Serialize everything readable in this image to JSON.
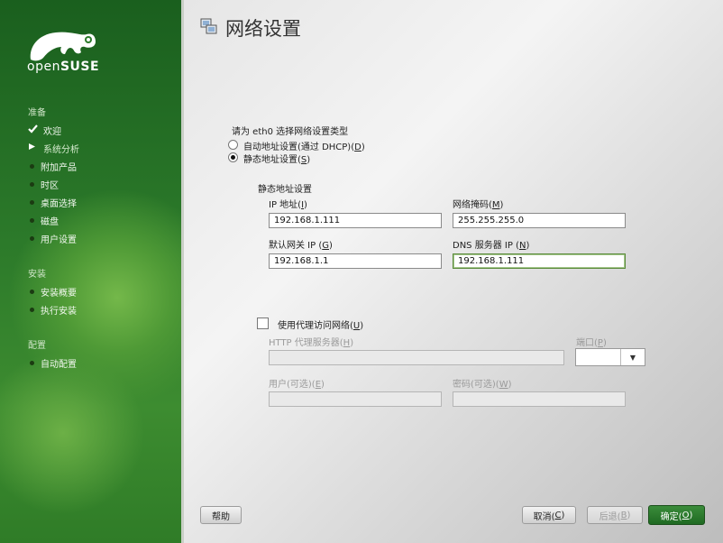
{
  "brand": {
    "logo_text_a": "open",
    "logo_text_b": "SUSE"
  },
  "sidebar": {
    "sections": [
      {
        "title": "准备",
        "items": [
          {
            "label": "欢迎",
            "state": "done"
          },
          {
            "label": "系统分析",
            "state": "current"
          },
          {
            "label": "附加产品",
            "state": "pending"
          },
          {
            "label": "时区",
            "state": "pending"
          },
          {
            "label": "桌面选择",
            "state": "pending"
          },
          {
            "label": "磁盘",
            "state": "pending"
          },
          {
            "label": "用户设置",
            "state": "pending"
          }
        ]
      },
      {
        "title": "安装",
        "items": [
          {
            "label": "安装概要",
            "state": "pending"
          },
          {
            "label": "执行安装",
            "state": "pending"
          }
        ]
      },
      {
        "title": "配置",
        "items": [
          {
            "label": "自动配置",
            "state": "pending"
          }
        ]
      }
    ]
  },
  "page": {
    "title": "网络设置"
  },
  "setup": {
    "prompt": "请为 eth0 选择网络设置类型",
    "dhcp_label": "自动地址设置(通过 DHCP)(",
    "dhcp_key": "D",
    "static_label": "静态地址设置(",
    "static_key": "S",
    "selected": "static"
  },
  "static": {
    "group_title": "静态地址设置",
    "ip_label": "IP 地址(",
    "ip_key": "I",
    "ip_value": "192.168.1.111",
    "mask_label": "网络掩码(",
    "mask_key": "M",
    "mask_value": "255.255.255.0",
    "gw_label": "默认网关 IP (",
    "gw_key": "G",
    "gw_value": "192.168.1.1",
    "dns_label": "DNS 服务器 IP (",
    "dns_key": "N",
    "dns_value": "192.168.1.111"
  },
  "proxy": {
    "checkbox_label": "使用代理访问网络(",
    "checkbox_key": "U",
    "checked": false,
    "http_label": "HTTP 代理服务器(",
    "http_key": "H",
    "http_value": "",
    "port_label": "端口(",
    "port_key": "P",
    "user_label": "用户(可选)(",
    "user_key": "E",
    "pass_label": "密码(可选)(",
    "pass_key": "W"
  },
  "buttons": {
    "help": "帮助",
    "cancel_label": "取消(",
    "cancel_key": "C",
    "back_label": "后退(",
    "back_key": "B",
    "ok_label": "确定(",
    "ok_key": "O"
  },
  "colors": {
    "sidebar_green": "#2c7a2a",
    "primary_button": "#1f6a22",
    "focus_border": "#5a8a3a"
  }
}
